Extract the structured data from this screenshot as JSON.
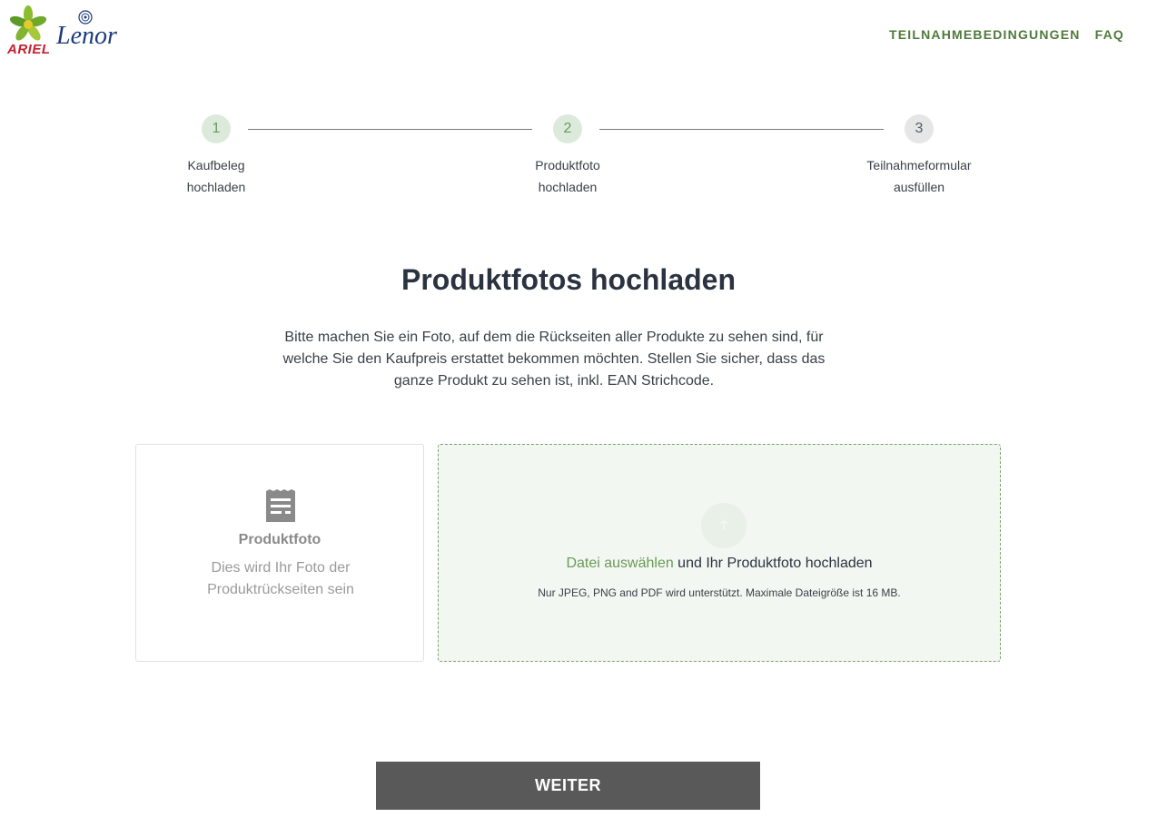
{
  "header": {
    "brand_ariel": "ARIEL",
    "brand_lenor": "Lenor",
    "nav": {
      "terms": "TEILNAHMEBEDINGUNGEN",
      "faq": "FAQ"
    }
  },
  "stepper": {
    "steps": [
      {
        "number": "1",
        "line1": "Kaufbeleg",
        "line2": "hochladen"
      },
      {
        "number": "2",
        "line1": "Produktfoto",
        "line2": "hochladen"
      },
      {
        "number": "3",
        "line1": "Teilnahmeformular",
        "line2": "ausfüllen"
      }
    ]
  },
  "main": {
    "title": "Produktfotos hochladen",
    "description": "Bitte machen Sie ein Foto, auf dem die Rückseiten aller Produkte zu sehen sind, für welche Sie den Kaufpreis erstattet bekommen möchten. Stellen Sie sicher, dass das ganze Produkt zu sehen ist, inkl. EAN Strichcode."
  },
  "preview": {
    "icon": "document-icon",
    "title": "Produktfoto",
    "text": "Dies wird Ihr Foto der Produktrückseiten sein"
  },
  "dropzone": {
    "icon": "upload-icon",
    "link": "Datei auswählen",
    "text": " und Ihr Produktfoto hochladen",
    "hint": "Nur JPEG, PNG and PDF wird unterstützt. Maximale Dateigröße ist 16 MB."
  },
  "actions": {
    "next": "WEITER"
  },
  "colors": {
    "accent_green": "#6a9a58",
    "nav_green": "#4f7a3a",
    "button_gray": "#595959",
    "ariel_red": "#c8202f",
    "lenor_blue": "#1d3b7a"
  }
}
